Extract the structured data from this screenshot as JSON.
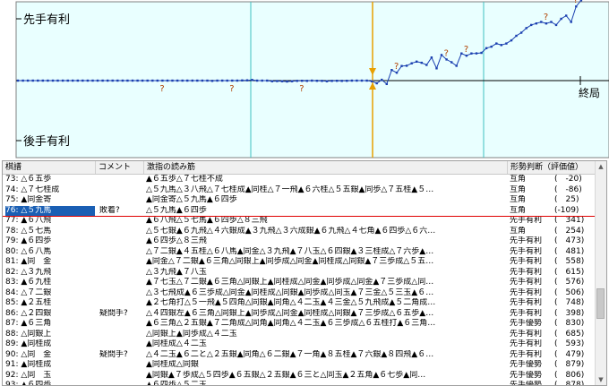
{
  "graph": {
    "top_label": "先手有利",
    "bottom_label": "後手有利",
    "end_label": "終局",
    "question_mark": "?",
    "colors": {
      "plot_bg": "#e9ffff",
      "line": "#1a3fb0",
      "cursor": "#e8a000",
      "vline": "#40c0c0",
      "question": "#b04000"
    }
  },
  "table": {
    "headers": {
      "move": "棋譜",
      "comment": "コメント",
      "reading": "激指の読み筋",
      "evaluation": "形勢判断（評価値）"
    },
    "rows": [
      {
        "move": "73: △６五歩",
        "comment": "",
        "reading": "▲６五歩△７七桂不成",
        "judgement": "互角",
        "value": "(　-20)"
      },
      {
        "move": "74: △７七桂成",
        "comment": "",
        "reading": "△５九馬△３八飛△７七桂成▲同桂△７一飛▲６六桂△５五銀▲同歩△７五桂▲５…",
        "judgement": "互角",
        "value": "(　-86)"
      },
      {
        "move": "75: ▲同金寄",
        "comment": "",
        "reading": "▲同金寄△５九馬▲６四歩",
        "judgement": "互角",
        "value": "(　25)"
      },
      {
        "move": "76: △５九馬",
        "comment": "敗着?",
        "reading": "△５九馬▲６四歩",
        "judgement": "互角",
        "value": "(-109)"
      },
      {
        "move": "77: ▲６八飛",
        "comment": "",
        "reading": "▲６八飛△５七馬▲６四歩△８三飛",
        "judgement": "先手有利",
        "value": "(　341)"
      },
      {
        "move": "78: △５七馬",
        "comment": "",
        "reading": "△５七銀▲６九飛△４六銀成▲３九飛△３六成銀▲６九飛△４七角▲６四歩△６六…",
        "judgement": "互角",
        "value": "(　254)"
      },
      {
        "move": "79: ▲６四歩",
        "comment": "",
        "reading": "▲６四歩△８三飛",
        "judgement": "先手有利",
        "value": "(　473)"
      },
      {
        "move": "80: △６八馬",
        "comment": "",
        "reading": "△７二銀▲４五桂△６八馬▲同金△３九飛▲７八玉△６四銀▲３三桂成△７六歩▲…",
        "judgement": "先手有利",
        "value": "(　481)"
      },
      {
        "move": "81: ▲同　金",
        "comment": "",
        "reading": "▲同金△７二銀▲６三角△同銀上▲同歩成△同金▲同桂成△同銀▲７三歩成△５五…",
        "judgement": "先手有利",
        "value": "(　558)"
      },
      {
        "move": "82: △３九飛",
        "comment": "",
        "reading": "△３九飛▲７八玉",
        "judgement": "先手有利",
        "value": "(　615)"
      },
      {
        "move": "83: ▲６九桂",
        "comment": "",
        "reading": "▲７七玉△７二銀▲６三角△同銀上▲同桂成△同金▲同歩成△同金▲７三歩成△同…",
        "judgement": "先手有利",
        "value": "(　576)"
      },
      {
        "move": "84: △７二銀",
        "comment": "",
        "reading": "△３七飛成▲６三歩成△同金▲同桂成△同銀▲同歩成△同玉▲７三金△５三玉▲６…",
        "judgement": "先手有利",
        "value": "(　506)"
      },
      {
        "move": "85: ▲２五桂",
        "comment": "",
        "reading": "▲２七角打△５一飛▲５四角△同銀▲同角△４二玉▲４三金△５九飛成▲５二角成…",
        "judgement": "先手有利",
        "value": "(　748)"
      },
      {
        "move": "86: △２四銀",
        "comment": "疑問手?",
        "reading": "△４四銀左▲６三角△同銀上▲同歩成△同金▲同桂成△同銀▲７三歩成△６五歩▲…",
        "judgement": "先手有利",
        "value": "(　398)"
      },
      {
        "move": "87: ▲６三角",
        "comment": "",
        "reading": "▲６三角△２五銀▲７二角成△同角▲同角△４二玉▲６三歩成△６五桂打▲６三角…",
        "judgement": "先手優勢",
        "value": "(　830)"
      },
      {
        "move": "88: △同銀上",
        "comment": "",
        "reading": "△同銀上▲同歩成△４二玉",
        "judgement": "先手有利",
        "value": "(　685)"
      },
      {
        "move": "89: ▲同桂成",
        "comment": "",
        "reading": "▲同桂成△４二玉",
        "judgement": "先手有利",
        "value": "(　593)"
      },
      {
        "move": "90: △同　金",
        "comment": "疑問手?",
        "reading": "△４二玉▲６二と△２五銀▲同角△６二銀▲７一角▲８五桂▲７六銀▲８四飛▲６…",
        "judgement": "先手有利",
        "value": "(　479)"
      },
      {
        "move": "91: ▲同桂成",
        "comment": "",
        "reading": "▲同桂成△同銀",
        "judgement": "先手優勢",
        "value": "(　879)"
      },
      {
        "move": "92: △同　玉",
        "comment": "",
        "reading": "▲同銀▲７歩成△５四歩▲６五銀△２五銀▲６三と△同玉▲２五角▲６七歩▲同…",
        "judgement": "先手優勢",
        "value": "(　806)"
      },
      {
        "move": "93: ▲６四歩",
        "comment": "",
        "reading": "▲６四歩△５二玉",
        "judgement": "先手優勢",
        "value": "(　878)"
      }
    ]
  },
  "chart_data": {
    "type": "line",
    "title": "",
    "xlabel": "",
    "ylabel": "",
    "series": [
      {
        "values": [
          0,
          0,
          0,
          0,
          0,
          0,
          0,
          0,
          0,
          0,
          0,
          0,
          0,
          0,
          0,
          0,
          0,
          0,
          0,
          0,
          0,
          0,
          0,
          0,
          0,
          0,
          0,
          0,
          0,
          0,
          0,
          0,
          0,
          0,
          0,
          0,
          0,
          0,
          0,
          -10,
          0,
          0,
          0,
          0,
          0,
          5,
          10,
          20,
          0,
          0,
          0,
          -20,
          -15,
          -20,
          -30,
          -20,
          -10,
          -5,
          -10,
          0,
          -5,
          -10,
          -20,
          -10,
          -5,
          -10,
          -5,
          0,
          0,
          0,
          0,
          -20,
          -86,
          25,
          -109,
          341,
          254,
          473,
          481,
          558,
          615,
          576,
          506,
          748,
          398,
          830,
          685,
          593,
          479,
          879,
          806,
          878,
          880,
          900,
          1050,
          1100,
          1200,
          1150,
          1200,
          1300,
          1450,
          1550,
          1700,
          1800,
          1850,
          1900,
          1850,
          1900,
          1800,
          2000,
          2100,
          1900,
          2400,
          2600,
          3500,
          3500
        ]
      }
    ],
    "question_marks_at": [
      29,
      43,
      57,
      76,
      86,
      90,
      106,
      112,
      117,
      118,
      119,
      120,
      121
    ]
  }
}
